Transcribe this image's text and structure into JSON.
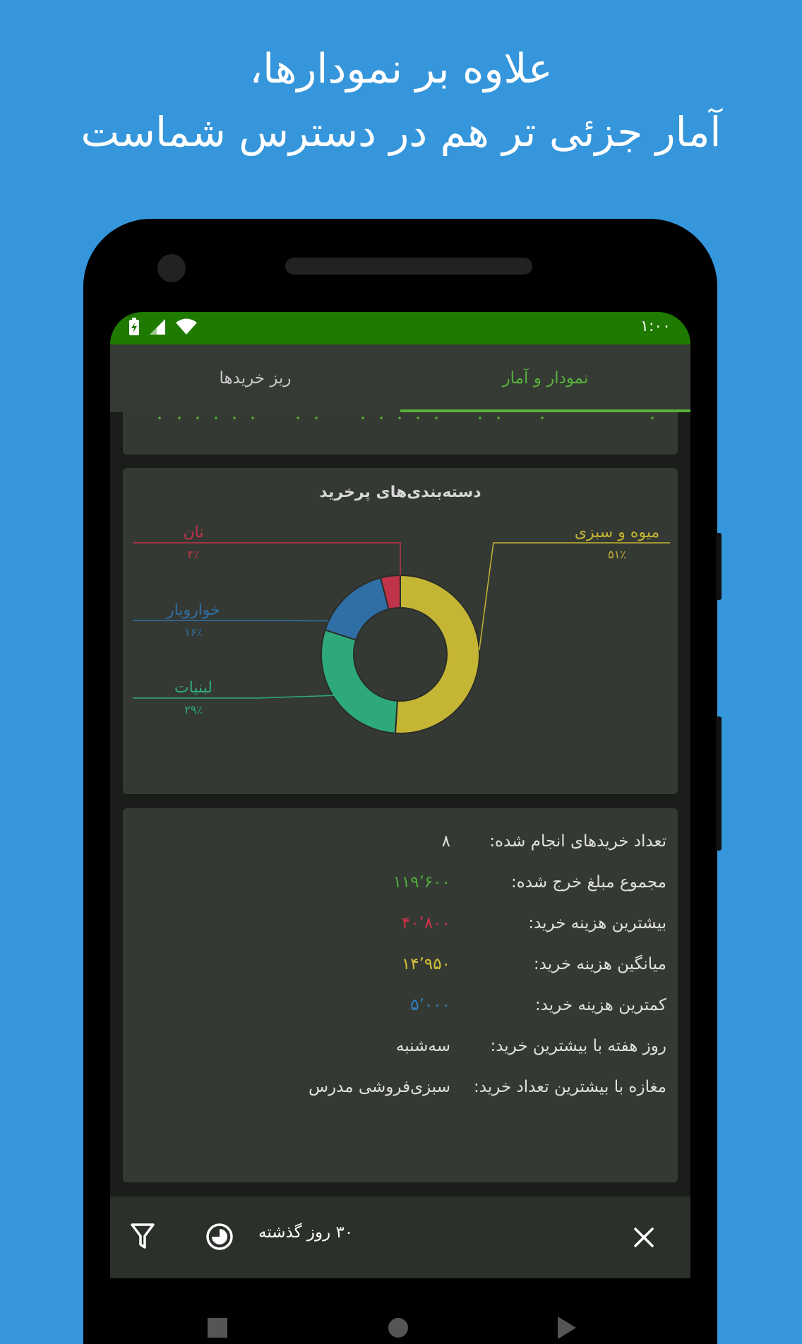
{
  "promo": {
    "line1": "علاوه بر نمودارها،",
    "line2": "آمار جزئی تر هم در دسترس شماست"
  },
  "status_bar": {
    "time": "۱:۰۰"
  },
  "tabs": [
    {
      "label": "نمودار و آمار",
      "active": true
    },
    {
      "label": "ریز خریدها",
      "active": false
    }
  ],
  "chart_card": {
    "title": "دسته‌بندی‌های پرخرید"
  },
  "chart_data": {
    "type": "pie",
    "categories": [
      "میوه و سبزی",
      "لبنیات",
      "خواروبار",
      "نان"
    ],
    "values": [
      51,
      29,
      16,
      4
    ],
    "value_labels": [
      "۵۱٪",
      "۲۹٪",
      "۱۶٪",
      "۴٪"
    ],
    "colors": [
      "#c5b535",
      "#2eaa7a",
      "#2f6fa6",
      "#c0344a"
    ],
    "title": "دسته‌بندی‌های پرخرید",
    "donut": true
  },
  "stats": {
    "rows": [
      {
        "label": "تعداد خریدهای انجام شده:",
        "value": "۸",
        "color": "#e0e0e0"
      },
      {
        "label": "مجموع مبلغ خرج شده:",
        "value": "۱۱۹٬۶۰۰",
        "color": "#4caf3a"
      },
      {
        "label": "بیشترین هزینه خرید:",
        "value": "۴۰٬۸۰۰",
        "color": "#d0334a"
      },
      {
        "label": "میانگین هزینه خرید:",
        "value": "۱۴٬۹۵۰",
        "color": "#d6c23a"
      },
      {
        "label": "کمترین هزینه خرید:",
        "value": "۵٬۰۰۰",
        "color": "#2f7ec2"
      },
      {
        "label": "روز هفته با بیشترین خرید:",
        "value": "سه‌شنبه",
        "color": "#e0e0e0"
      },
      {
        "label": "مغازه با بیشترین تعداد خرید:",
        "value": "سبزی‌فروشی مدرس",
        "color": "#e0e0e0"
      }
    ]
  },
  "bottom_bar": {
    "period_label": "۳۰ روز گذشته"
  }
}
